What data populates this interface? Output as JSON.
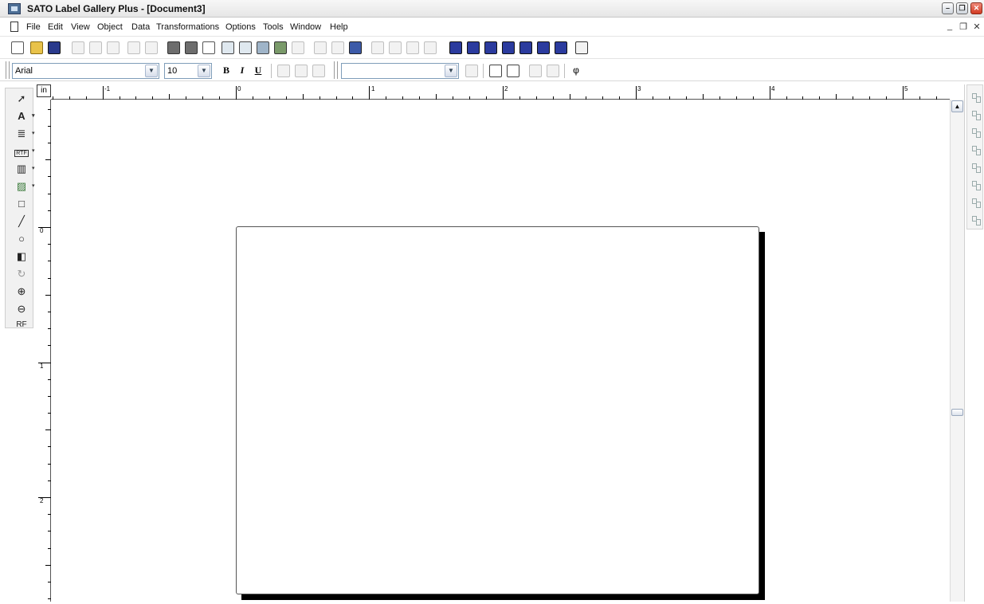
{
  "window": {
    "title": "SATO Label Gallery Plus - [Document3]",
    "min": "–",
    "restore": "❐",
    "close": "✕"
  },
  "menubar": {
    "items": [
      "File",
      "Edit",
      "View",
      "Object",
      "Data",
      "Transformations",
      "Options",
      "Tools",
      "Window",
      "Help"
    ],
    "mdi_min": "_",
    "mdi_restore": "❐",
    "mdi_close": "✕"
  },
  "format_toolbar": {
    "font_family": "Arial",
    "font_size": "10",
    "bold": "B",
    "italic": "I",
    "underline": "U",
    "style_select": "",
    "symbol": "φ",
    "combo_arrow": "▼"
  },
  "toolbox": {
    "text_tool": "A",
    "rtf_tool": "RTF",
    "rf_tool": "RF",
    "dropdown": "▾"
  },
  "rulers": {
    "unit": "in",
    "top_labels": [
      "-1",
      "0",
      "1",
      "2",
      "3",
      "4",
      "5"
    ],
    "left_labels": [
      "0",
      "1",
      "2"
    ]
  },
  "scrollbar": {
    "up": "▲"
  }
}
